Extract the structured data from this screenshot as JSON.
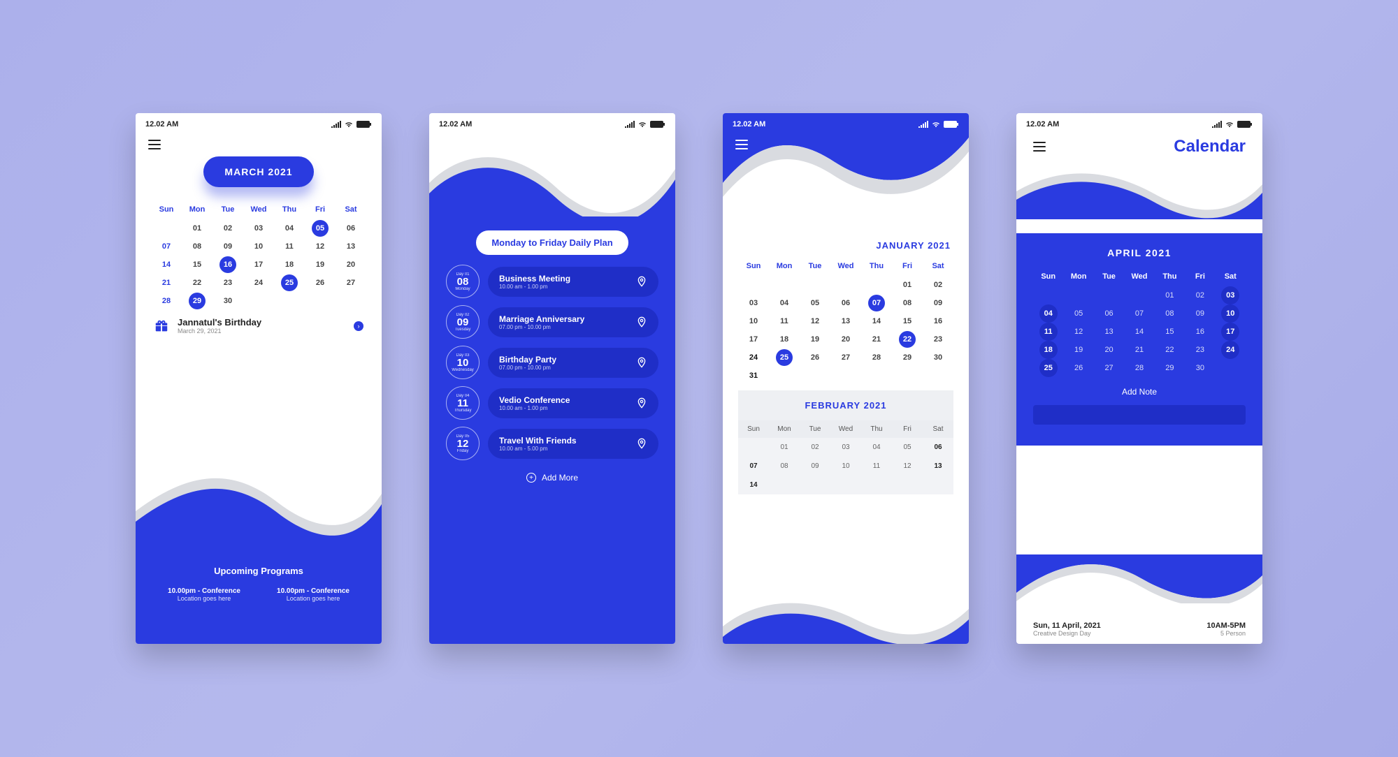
{
  "status_time": "12.02 AM",
  "weekdays": [
    "Sun",
    "Mon",
    "Tue",
    "Wed",
    "Thu",
    "Fri",
    "Sat"
  ],
  "screen1": {
    "month": "MARCH 2021",
    "grid": [
      [
        "",
        "01",
        "02",
        "03",
        "04",
        "05",
        "06"
      ],
      [
        "07",
        "08",
        "09",
        "10",
        "11",
        "12",
        "13"
      ],
      [
        "14",
        "15",
        "16",
        "17",
        "18",
        "19",
        "20"
      ],
      [
        "21",
        "22",
        "23",
        "24",
        "25",
        "26",
        "27"
      ],
      [
        "28",
        "29",
        "30",
        "",
        "",
        "",
        ""
      ]
    ],
    "highlighted": [
      "05",
      "16",
      "25",
      "29"
    ],
    "blue_col0": [
      "07",
      "14",
      "21",
      "28"
    ],
    "event": {
      "title": "Jannatul's Birthday",
      "sub": "March 29, 2021"
    },
    "upcoming": {
      "title": "Upcoming Programs",
      "items": [
        {
          "line1": "10.00pm - Conference",
          "line2": "Location goes here"
        },
        {
          "line1": "10.00pm - Conference",
          "line2": "Location goes here"
        }
      ]
    }
  },
  "screen2": {
    "plan_title": "Monday to Friday Daily Plan",
    "items": [
      {
        "lbl": "Day 01",
        "num": "08",
        "dn": "Monday",
        "title": "Business Meeting",
        "time": "10.00 am - 1.00 pm"
      },
      {
        "lbl": "Day 02",
        "num": "09",
        "dn": "Tuesday",
        "title": "Marriage Anniversary",
        "time": "07.00 pm - 10.00 pm"
      },
      {
        "lbl": "Day 03",
        "num": "10",
        "dn": "Wednesday",
        "title": "Birthday Party",
        "time": "07.00 pm - 10.00 pm"
      },
      {
        "lbl": "Day 04",
        "num": "11",
        "dn": "Thursday",
        "title": "Vedio Conference",
        "time": "10.00 am - 1.00 pm"
      },
      {
        "lbl": "Day 05",
        "num": "12",
        "dn": "Friday",
        "title": "Travel With Friends",
        "time": "10.00 am - 5.00 pm"
      }
    ],
    "add_more": "Add More"
  },
  "screen3": {
    "month1": "JANUARY 2021",
    "grid1": [
      [
        "",
        "",
        "",
        "",
        "",
        "01",
        "02"
      ],
      [
        "03",
        "04",
        "05",
        "06",
        "07",
        "08",
        "09"
      ],
      [
        "10",
        "11",
        "12",
        "13",
        "14",
        "15",
        "16"
      ],
      [
        "17",
        "18",
        "19",
        "20",
        "21",
        "22",
        "23"
      ],
      [
        "24",
        "25",
        "26",
        "27",
        "28",
        "29",
        "30"
      ],
      [
        "31",
        "",
        "",
        "",
        "",
        "",
        ""
      ]
    ],
    "hl1": [
      "07",
      "22",
      "25"
    ],
    "bold1": [
      "24",
      "31"
    ],
    "month2": "FEBRUARY 2021",
    "grid2": [
      [
        "",
        "01",
        "02",
        "03",
        "04",
        "05",
        "06"
      ],
      [
        "07",
        "08",
        "09",
        "10",
        "11",
        "12",
        "13"
      ],
      [
        "14",
        "",
        "",
        "",
        "",
        "",
        ""
      ]
    ],
    "bold2": [
      "06",
      "07",
      "13",
      "14"
    ]
  },
  "screen4": {
    "title": "Calendar",
    "month": "APRIL 2021",
    "grid": [
      [
        "",
        "",
        "",
        "",
        "01",
        "02",
        "03"
      ],
      [
        "04",
        "05",
        "06",
        "07",
        "08",
        "09",
        "10"
      ],
      [
        "11",
        "12",
        "13",
        "14",
        "15",
        "16",
        "17"
      ],
      [
        "18",
        "19",
        "20",
        "21",
        "22",
        "23",
        "24"
      ],
      [
        "25",
        "26",
        "27",
        "28",
        "29",
        "30",
        ""
      ]
    ],
    "hl": [
      "03",
      "04",
      "10",
      "11",
      "17",
      "18",
      "24",
      "25"
    ],
    "add_note": "Add Note",
    "foot": {
      "date": "Sun, 11 April,  2021",
      "event": "Creative Design Day",
      "time": "10AM-5PM",
      "people": "5 Person"
    }
  }
}
